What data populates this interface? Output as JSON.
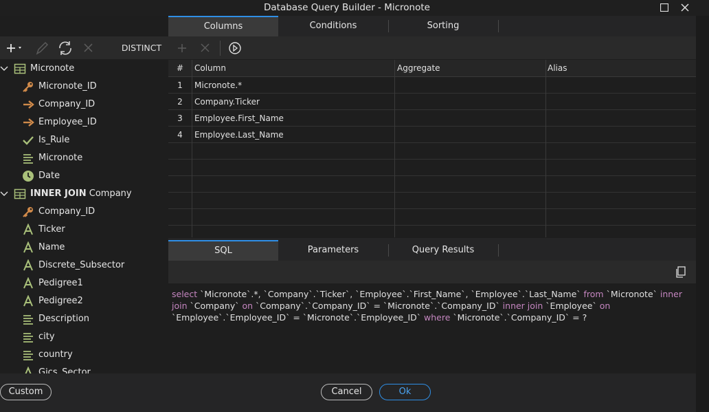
{
  "window": {
    "title": "Database Query Builder - Micronote",
    "maximize_icon": "maximize-icon",
    "close_icon": "close-icon"
  },
  "top_tabs": [
    "Columns",
    "Conditions",
    "Sorting"
  ],
  "toolbar": {
    "distinct_label": "DISTINCT"
  },
  "tree": {
    "tables": [
      {
        "label": "Micronote",
        "join_prefix": ""
      },
      {
        "label": "Company",
        "join_prefix": "INNER JOIN"
      }
    ],
    "micronote_fields": [
      {
        "label": "Micronote_ID",
        "icon": "key-icon"
      },
      {
        "label": "Company_ID",
        "icon": "foreign-key-arrow-icon"
      },
      {
        "label": "Employee_ID",
        "icon": "foreign-key-arrow-icon"
      },
      {
        "label": "Is_Rule",
        "icon": "check-icon"
      },
      {
        "label": "Micronote",
        "icon": "text-lines-icon"
      },
      {
        "label": "Date",
        "icon": "clock-icon"
      }
    ],
    "company_fields": [
      {
        "label": "Company_ID",
        "icon": "key-icon"
      },
      {
        "label": "Ticker",
        "icon": "text-a-icon"
      },
      {
        "label": "Name",
        "icon": "text-a-icon"
      },
      {
        "label": "Discrete_Subsector",
        "icon": "text-a-icon"
      },
      {
        "label": "Pedigree1",
        "icon": "text-a-icon"
      },
      {
        "label": "Pedigree2",
        "icon": "text-a-icon"
      },
      {
        "label": "Description",
        "icon": "text-lines-icon"
      },
      {
        "label": "city",
        "icon": "text-lines-icon"
      },
      {
        "label": "country",
        "icon": "text-lines-icon"
      },
      {
        "label": "Gics_Sector",
        "icon": "text-a-icon"
      }
    ]
  },
  "grid": {
    "headers": {
      "num": "#",
      "column": "Column",
      "aggregate": "Aggregate",
      "alias": "Alias"
    },
    "rows": [
      {
        "num": "1",
        "column": "Micronote.*"
      },
      {
        "num": "2",
        "column": "Company.Ticker"
      },
      {
        "num": "3",
        "column": "Employee.First_Name"
      },
      {
        "num": "4",
        "column": "Employee.Last_Name"
      }
    ]
  },
  "bottom_tabs": [
    "SQL",
    "Parameters",
    "Query Results"
  ],
  "sql": {
    "t1": "select ",
    "t2": "`Micronote`.*, `Company`.`Ticker`, `Employee`.`First_Name`, `Employee`.`Last_Name` ",
    "t3": "from ",
    "t4": "`Micronote` ",
    "t5": "inner join ",
    "t6": "`Company` ",
    "t7": "on ",
    "t8": "`Company`.`Company_ID` = `Micronote`.`Company_ID` ",
    "t9": "inner join ",
    "t10": "`Employee` ",
    "t11": "on ",
    "t12": "`Employee`.`Employee_ID` = `Micronote`.`Employee_ID` ",
    "t13": "where ",
    "t14": "`Micronote`.`Company_ID` = ?"
  },
  "footer": {
    "custom": "Custom",
    "cancel": "Cancel",
    "ok": "Ok"
  },
  "colors": {
    "accent": "#2f8fe6",
    "keyword": "#c586c0",
    "key_icon": "#d08a4a",
    "field_icon": "#a9c07a"
  }
}
